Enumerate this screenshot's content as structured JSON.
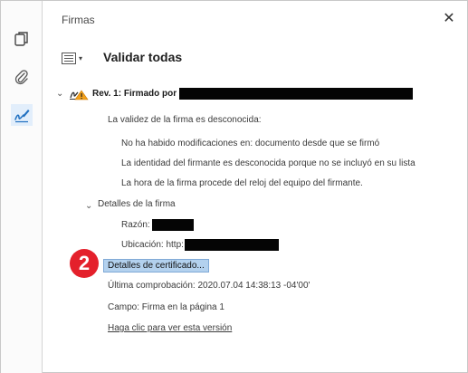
{
  "sidebar": {
    "tools": [
      {
        "name": "copy-pages-icon"
      },
      {
        "name": "paperclip-icon"
      },
      {
        "name": "signature-pen-icon",
        "active": true
      }
    ]
  },
  "panel": {
    "title": "Firmas",
    "close_glyph": "✕",
    "validate_all": "Validar todas"
  },
  "signature": {
    "header": "Rev. 1: Firmado por",
    "validity": "La validez de la firma es desconocida:",
    "no_changes": "No ha habido modificaciones en: documento desde que se firmó",
    "identity": "La identidad del firmante es desconocida porque no se incluyó en su lista",
    "time_source": "La hora de la firma procede del reloj del equipo del firmante.",
    "details_header": "Detalles de la firma",
    "reason_label": "Razón:",
    "location_label": "Ubicación: http:",
    "cert_button": "Detalles de certificado...",
    "last_check": "Última comprobación: 2020.07.04 14:38:13 -04'00'",
    "field": "Campo: Firma en la página 1",
    "view_version": "Haga clic para ver esta versión"
  },
  "annotation": {
    "step_number": "2",
    "badge_color": "#e4202b"
  }
}
